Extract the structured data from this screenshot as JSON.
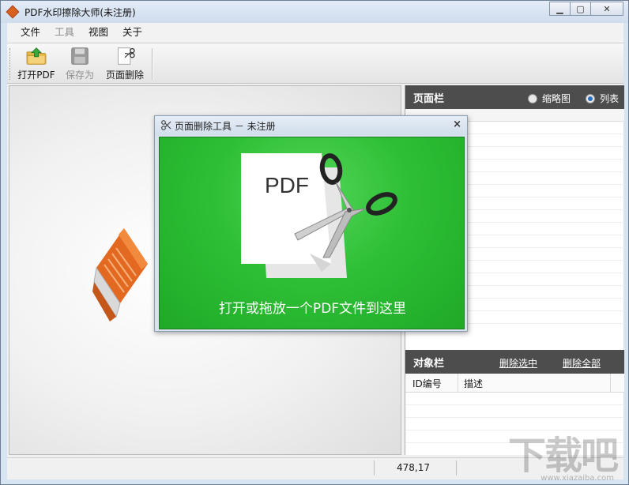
{
  "window": {
    "title": "PDF水印擦除大师(未注册)",
    "controls": [
      "minimize",
      "maximize",
      "close"
    ]
  },
  "menu": {
    "items": [
      {
        "label": "文件",
        "enabled": true
      },
      {
        "label": "工具",
        "enabled": false
      },
      {
        "label": "视图",
        "enabled": true
      },
      {
        "label": "关于",
        "enabled": true
      }
    ]
  },
  "toolbar": {
    "open_label": "打开PDF",
    "save_label": "保存为",
    "delete_label": "页面删除"
  },
  "page_panel": {
    "title": "页面栏",
    "view_options": [
      {
        "label": "缩略图",
        "selected": false
      },
      {
        "label": "列表",
        "selected": true
      }
    ]
  },
  "object_panel": {
    "title": "对象栏",
    "delete_selected": "删除选中",
    "delete_all": "删除全部",
    "columns": [
      "ID编号",
      "描述"
    ]
  },
  "status": {
    "coords": "478,17"
  },
  "dialog": {
    "title": "页面删除工具 － 未注册",
    "close_glyph": "×",
    "pdf_badge": "PDF",
    "drop_prompt": "打开或拖放一个PDF文件到这里"
  },
  "colors": {
    "dropzone_green": "#2fbf36",
    "panel_header": "#4d4d4d",
    "logo_orange": "#e2691f"
  },
  "watermark": {
    "text": "下载吧",
    "sub": "www.xiazaiba.com"
  }
}
